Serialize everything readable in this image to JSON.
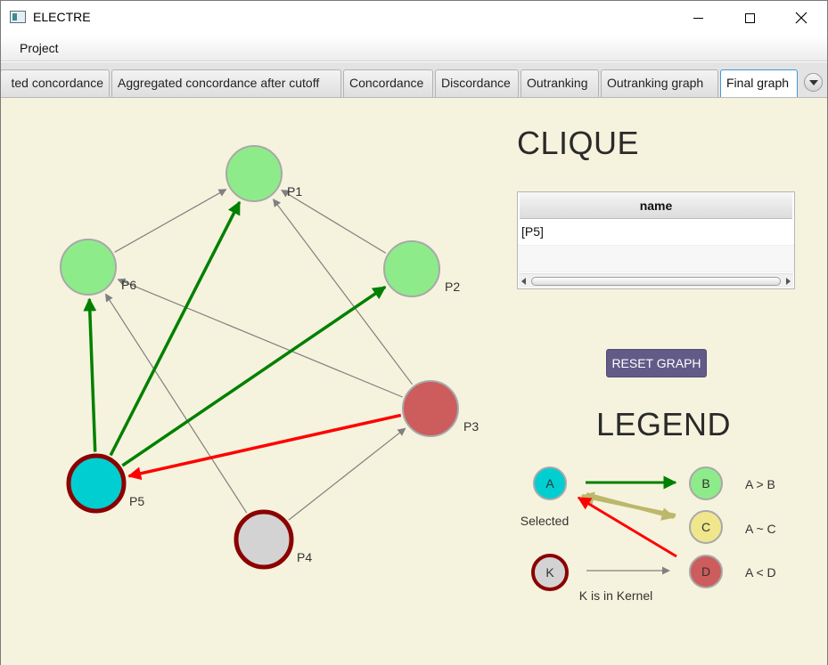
{
  "window": {
    "title": "ELECTRE",
    "app_icon": "window-app-icon",
    "controls": [
      "minimize-icon",
      "maximize-icon",
      "close-icon"
    ]
  },
  "menu": {
    "items": [
      {
        "label": "Project"
      }
    ]
  },
  "tabs": [
    {
      "label": "Aggregated concordance",
      "visible_label": "ted concordance",
      "active": false
    },
    {
      "label": "Aggregated concordance after cutoff",
      "active": false
    },
    {
      "label": "Concordance",
      "active": false
    },
    {
      "label": "Discordance",
      "active": false
    },
    {
      "label": "Outranking",
      "active": false
    },
    {
      "label": "Outranking graph",
      "active": false
    },
    {
      "label": "Final graph",
      "active": true
    }
  ],
  "tab_overflow_icon": "chevron-down-icon",
  "graph": {
    "nodes": [
      {
        "id": "P1",
        "label": "P1",
        "role": "normal"
      },
      {
        "id": "P2",
        "label": "P2",
        "role": "normal"
      },
      {
        "id": "P3",
        "label": "P3",
        "role": "dominating"
      },
      {
        "id": "P4",
        "label": "P4",
        "role": "kernel"
      },
      {
        "id": "P5",
        "label": "P5",
        "role": "selected-kernel"
      },
      {
        "id": "P6",
        "label": "P6",
        "role": "normal"
      }
    ],
    "edges": [
      {
        "from": "P6",
        "to": "P1",
        "type": "gray"
      },
      {
        "from": "P2",
        "to": "P1",
        "type": "gray"
      },
      {
        "from": "P3",
        "to": "P1",
        "type": "gray"
      },
      {
        "from": "P3",
        "to": "P6",
        "type": "gray"
      },
      {
        "from": "P4",
        "to": "P6",
        "type": "gray"
      },
      {
        "from": "P4",
        "to": "P3",
        "type": "gray"
      },
      {
        "from": "P5",
        "to": "P6",
        "type": "green"
      },
      {
        "from": "P5",
        "to": "P1",
        "type": "green"
      },
      {
        "from": "P5",
        "to": "P2",
        "type": "green"
      },
      {
        "from": "P3",
        "to": "P5",
        "type": "red"
      }
    ]
  },
  "clique": {
    "title": "CLIQUE",
    "column": "name",
    "rows": [
      "[P5]"
    ]
  },
  "reset_button": "RESET GRAPH",
  "legend": {
    "title": "LEGEND",
    "node_a": "A",
    "node_b": "B",
    "node_c": "C",
    "node_d": "D",
    "node_k": "K",
    "selected_label": "Selected",
    "kernel_label": "K is in Kernel",
    "rel_b": "A > B",
    "rel_c": "A ~ C",
    "rel_d": "A < D"
  },
  "colors": {
    "background": "#f5f3dd",
    "node_green": "#8eeb8a",
    "node_red": "#cd5c5c",
    "node_gray": "#d3d3d3",
    "node_cyan": "#00ced1",
    "node_yellow": "#f0e68c",
    "kernel_border": "#8b0000",
    "node_border": "#a8a8a8",
    "edge_green": "#008000",
    "edge_red": "#ff0000",
    "edge_gray": "#808080",
    "edge_khaki": "#bdb76b",
    "button": "#625a87"
  }
}
